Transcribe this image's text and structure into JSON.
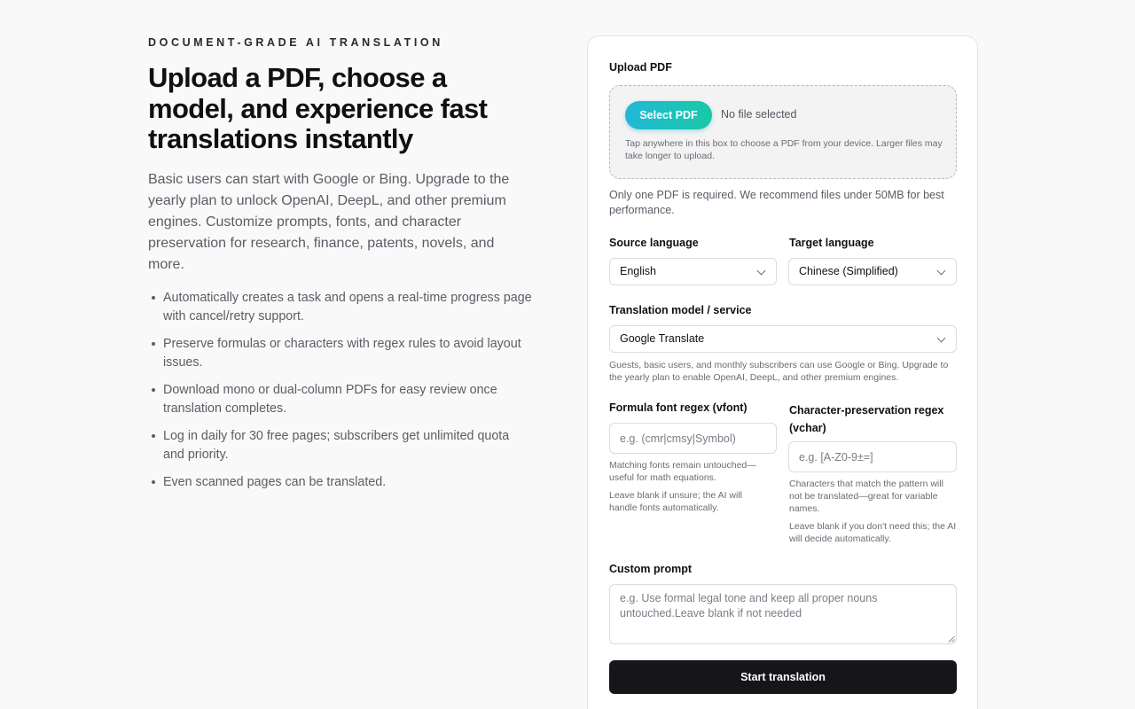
{
  "hero": {
    "eyebrow": "DOCUMENT-GRADE AI TRANSLATION",
    "headline": "Upload a PDF, choose a model, and experience fast translations instantly",
    "intro": "Basic users can start with Google or Bing. Upgrade to the yearly plan to unlock OpenAI, DeepL, and other premium engines. Customize prompts, fonts, and character preservation for research, finance, patents, novels, and more.",
    "bullets": [
      "Automatically creates a task and opens a real-time progress page with cancel/retry support.",
      "Preserve formulas or characters with regex rules to avoid layout issues.",
      "Download mono or dual-column PDFs for easy review once translation completes.",
      "Log in daily for 30 free pages; subscribers get unlimited quota and priority.",
      "Even scanned pages can be translated."
    ]
  },
  "form": {
    "upload_label": "Upload PDF",
    "select_button": "Select PDF",
    "file_status": "No file selected",
    "dropzone_hint": "Tap anywhere in this box to choose a PDF from your device. Larger files may take longer to upload.",
    "upload_note": "Only one PDF is required. We recommend files under 50MB for best performance.",
    "source_label": "Source language",
    "source_value": "English",
    "target_label": "Target language",
    "target_value": "Chinese (Simplified)",
    "model_label": "Translation model / service",
    "model_value": "Google Translate",
    "model_note": "Guests, basic users, and monthly subscribers can use Google or Bing. Upgrade to the yearly plan to enable OpenAI, DeepL, and other premium engines.",
    "vfont_label": "Formula font regex (vfont)",
    "vfont_placeholder": "e.g. (cmr|cmsy|Symbol)",
    "vfont_note1": "Matching fonts remain untouched—useful for math equations.",
    "vfont_note2": "Leave blank if unsure; the AI will handle fonts automatically.",
    "vchar_label": "Character-preservation regex (vchar)",
    "vchar_placeholder": "e.g. [A-Z0-9±=]",
    "vchar_note1": "Characters that match the pattern will not be translated—great for variable names.",
    "vchar_note2": "Leave blank if you don't need this; the AI will decide automatically.",
    "prompt_label": "Custom prompt",
    "prompt_placeholder": "e.g. Use formal legal tone and keep all proper nouns untouched.Leave blank if not needed",
    "start_button": "Start translation"
  }
}
